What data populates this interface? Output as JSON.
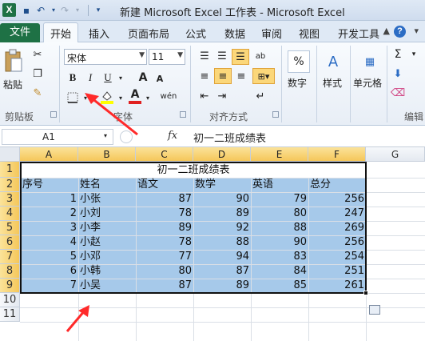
{
  "window": {
    "app_icon": "X",
    "title": "新建 Microsoft Excel 工作表 - Microsoft Excel"
  },
  "tabs": {
    "file": "文件",
    "items": [
      "开始",
      "插入",
      "页面布局",
      "公式",
      "数据",
      "审阅",
      "视图",
      "开发工具"
    ],
    "active": "开始",
    "help": "?"
  },
  "ribbon": {
    "clipboard": {
      "paste": "粘贴",
      "label": "剪贴板"
    },
    "font": {
      "name": "宋体",
      "size": "11",
      "bold": "B",
      "italic": "I",
      "underline": "U",
      "grow": "A",
      "shrink": "A",
      "color_letter": "A",
      "wen": "wén",
      "label": "字体"
    },
    "alignment": {
      "label": "对齐方式"
    },
    "number": {
      "label": "数字",
      "percent": "%"
    },
    "styles": {
      "label": "样式"
    },
    "cells": {
      "label": "单元格"
    },
    "editing": {
      "label": "编辑",
      "sigma": "Σ"
    },
    "colors": {
      "highlight": "#ffff00",
      "font_color": "#e02020",
      "accent": "#1e7145"
    }
  },
  "formula_bar": {
    "name_box": "A1",
    "fx": "fx",
    "content": "初一二班成绩表"
  },
  "grid": {
    "columns": [
      "A",
      "B",
      "C",
      "D",
      "E",
      "F",
      "G"
    ],
    "rows": [
      "1",
      "2",
      "3",
      "4",
      "5",
      "6",
      "7",
      "8",
      "9",
      "10",
      "11"
    ],
    "title": "初一二班成绩表",
    "headers": [
      "序号",
      "姓名",
      "语文",
      "数学",
      "英语",
      "总分"
    ],
    "data": [
      [
        "1",
        "小张",
        "87",
        "90",
        "79",
        "256"
      ],
      [
        "2",
        "小刘",
        "78",
        "89",
        "80",
        "247"
      ],
      [
        "3",
        "小李",
        "89",
        "92",
        "88",
        "269"
      ],
      [
        "4",
        "小赵",
        "78",
        "88",
        "90",
        "256"
      ],
      [
        "5",
        "小邓",
        "77",
        "94",
        "83",
        "254"
      ],
      [
        "6",
        "小韩",
        "80",
        "87",
        "84",
        "251"
      ],
      [
        "7",
        "小吴",
        "87",
        "89",
        "85",
        "261"
      ]
    ]
  }
}
